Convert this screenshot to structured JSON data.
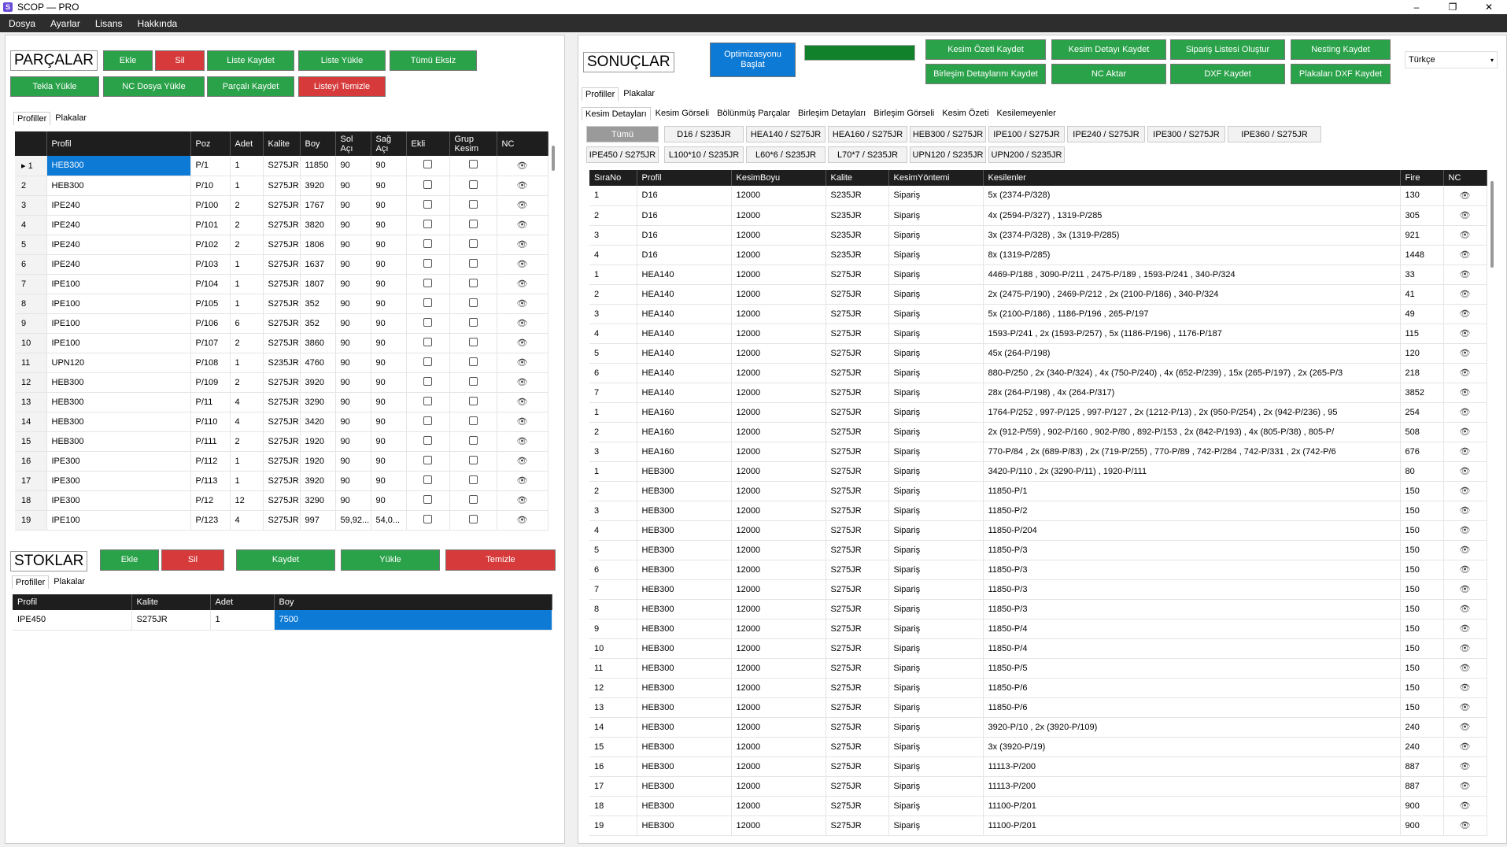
{
  "window": {
    "title": "SCOP — PRO",
    "icon_letter": "S",
    "controls": [
      "–",
      "❐",
      "✕"
    ]
  },
  "menu": [
    "Dosya",
    "Ayarlar",
    "Lisans",
    "Hakkında"
  ],
  "parts": {
    "title": "PARÇALAR",
    "buttons": {
      "add": "Ekle",
      "delete": "Sil",
      "save_list": "Liste Kaydet",
      "load_list": "Liste Yükle",
      "all_missing": "Tümü Eksiz",
      "tekla_load": "Tekla Yükle",
      "nc_load": "NC Dosya Yükle",
      "save_parts": "Parçalı Kaydet",
      "clear_list": "Listeyi Temizle"
    },
    "tabs": [
      "Profiller",
      "Plakalar"
    ],
    "columns": [
      "Profil",
      "Poz",
      "Adet",
      "Kalite",
      "Boy",
      "Sol Açı",
      "Sağ Açı",
      "Ekli",
      "Grup Kesim",
      "NC"
    ],
    "rows": [
      [
        "1",
        "HEB300",
        "P/1",
        "1",
        "S275JR",
        "11850",
        "90",
        "90"
      ],
      [
        "2",
        "HEB300",
        "P/10",
        "1",
        "S275JR",
        "3920",
        "90",
        "90"
      ],
      [
        "3",
        "IPE240",
        "P/100",
        "2",
        "S275JR",
        "1767",
        "90",
        "90"
      ],
      [
        "4",
        "IPE240",
        "P/101",
        "2",
        "S275JR",
        "3820",
        "90",
        "90"
      ],
      [
        "5",
        "IPE240",
        "P/102",
        "2",
        "S275JR",
        "1806",
        "90",
        "90"
      ],
      [
        "6",
        "IPE240",
        "P/103",
        "1",
        "S275JR",
        "1637",
        "90",
        "90"
      ],
      [
        "7",
        "IPE100",
        "P/104",
        "1",
        "S275JR",
        "1807",
        "90",
        "90"
      ],
      [
        "8",
        "IPE100",
        "P/105",
        "1",
        "S275JR",
        "352",
        "90",
        "90"
      ],
      [
        "9",
        "IPE100",
        "P/106",
        "6",
        "S275JR",
        "352",
        "90",
        "90"
      ],
      [
        "10",
        "IPE100",
        "P/107",
        "2",
        "S275JR",
        "3860",
        "90",
        "90"
      ],
      [
        "11",
        "UPN120",
        "P/108",
        "1",
        "S235JR",
        "4760",
        "90",
        "90"
      ],
      [
        "12",
        "HEB300",
        "P/109",
        "2",
        "S275JR",
        "3920",
        "90",
        "90"
      ],
      [
        "13",
        "HEB300",
        "P/11",
        "4",
        "S275JR",
        "3290",
        "90",
        "90"
      ],
      [
        "14",
        "HEB300",
        "P/110",
        "4",
        "S275JR",
        "3420",
        "90",
        "90"
      ],
      [
        "15",
        "HEB300",
        "P/111",
        "2",
        "S275JR",
        "1920",
        "90",
        "90"
      ],
      [
        "16",
        "IPE300",
        "P/112",
        "1",
        "S275JR",
        "1920",
        "90",
        "90"
      ],
      [
        "17",
        "IPE300",
        "P/113",
        "1",
        "S275JR",
        "3920",
        "90",
        "90"
      ],
      [
        "18",
        "IPE300",
        "P/12",
        "12",
        "S275JR",
        "3290",
        "90",
        "90"
      ],
      [
        "19",
        "IPE100",
        "P/123",
        "4",
        "S275JR",
        "997",
        "59,92...",
        "54,0..."
      ]
    ]
  },
  "stocks": {
    "title": "STOKLAR",
    "buttons": {
      "add": "Ekle",
      "delete": "Sil",
      "save": "Kaydet",
      "load": "Yükle",
      "clear": "Temizle"
    },
    "tabs": [
      "Profiller",
      "Plakalar"
    ],
    "columns": [
      "Profil",
      "Kalite",
      "Adet",
      "Boy"
    ],
    "rows": [
      [
        "IPE450",
        "S275JR",
        "1",
        "7500"
      ]
    ]
  },
  "results": {
    "title": "SONUÇLAR",
    "start_button": "Optimizasyonu Başlat",
    "progress": 1.0,
    "buttons": {
      "cut_summary": "Kesim Özeti Kaydet",
      "cut_detail": "Kesim Detayı Kaydet",
      "order_list": "Sipariş Listesi Oluştur",
      "nesting": "Nesting Kaydet",
      "merge_details": "Birleşim Detaylarını Kaydet",
      "nc_export": "NC Aktar",
      "dxf": "DXF Kaydet",
      "plate_dxf": "Plakaları DXF Kaydet"
    },
    "language": "Türkçe",
    "tabs1": [
      "Profiller",
      "Plakalar"
    ],
    "tabs2": [
      "Kesim Detayları",
      "Kesim Görseli",
      "Bölünmüş Parçalar",
      "Birleşim Detayları",
      "Birleşim Görseli",
      "Kesim Özeti",
      "Kesilemeyenler"
    ],
    "filters": [
      "Tümü",
      "D16 / S235JR",
      "HEA140 / S275JR",
      "HEA160 / S275JR",
      "HEB300 / S275JR",
      "IPE100 / S275JR",
      "IPE240 / S275JR",
      "IPE300 / S275JR",
      "IPE360 / S275JR",
      "IPE450 / S275JR",
      "L100*10 / S235JR",
      "L60*6 / S235JR",
      "L70*7 / S235JR",
      "UPN120 / S235JR",
      "UPN200 / S235JR"
    ],
    "columns": [
      "SıraNo",
      "Profil",
      "KesimBoyu",
      "Kalite",
      "KesimYöntemi",
      "Kesilenler",
      "Fire",
      "NC"
    ],
    "rows": [
      [
        "1",
        "D16",
        "12000",
        "S235JR",
        "Sipariş",
        "5x (2374-P/328)",
        "130"
      ],
      [
        "2",
        "D16",
        "12000",
        "S235JR",
        "Sipariş",
        "4x (2594-P/327) ,   1319-P/285",
        "305"
      ],
      [
        "3",
        "D16",
        "12000",
        "S235JR",
        "Sipariş",
        "3x (2374-P/328) ,   3x (1319-P/285)",
        "921"
      ],
      [
        "4",
        "D16",
        "12000",
        "S235JR",
        "Sipariş",
        "8x (1319-P/285)",
        "1448"
      ],
      [
        "1",
        "HEA140",
        "12000",
        "S275JR",
        "Sipariş",
        "4469-P/188 ,   3090-P/211 ,   2475-P/189 ,   1593-P/241 ,   340-P/324",
        "33"
      ],
      [
        "2",
        "HEA140",
        "12000",
        "S275JR",
        "Sipariş",
        "2x (2475-P/190) ,   2469-P/212 ,   2x (2100-P/186) ,   340-P/324",
        "41"
      ],
      [
        "3",
        "HEA140",
        "12000",
        "S275JR",
        "Sipariş",
        "5x (2100-P/186) ,   1186-P/196 ,   265-P/197",
        "49"
      ],
      [
        "4",
        "HEA140",
        "12000",
        "S275JR",
        "Sipariş",
        "1593-P/241 ,   2x (1593-P/257) ,   5x (1186-P/196) ,   1176-P/187",
        "115"
      ],
      [
        "5",
        "HEA140",
        "12000",
        "S275JR",
        "Sipariş",
        "45x (264-P/198)",
        "120"
      ],
      [
        "6",
        "HEA140",
        "12000",
        "S275JR",
        "Sipariş",
        "880-P/250 ,   2x (340-P/324) ,   4x (750-P/240) ,   4x (652-P/239) ,   15x (265-P/197) ,   2x (265-P/3",
        "218"
      ],
      [
        "7",
        "HEA140",
        "12000",
        "S275JR",
        "Sipariş",
        "28x (264-P/198) ,   4x (264-P/317)",
        "3852"
      ],
      [
        "1",
        "HEA160",
        "12000",
        "S275JR",
        "Sipariş",
        "1764-P/252 ,   997-P/125 ,   997-P/127 ,   2x (1212-P/13) ,   2x (950-P/254) ,   2x (942-P/236) ,   95",
        "254"
      ],
      [
        "2",
        "HEA160",
        "12000",
        "S275JR",
        "Sipariş",
        "2x (912-P/59) ,   902-P/160 ,   902-P/80 ,   892-P/153 ,   2x (842-P/193) ,   4x (805-P/38) ,   805-P/",
        "508"
      ],
      [
        "3",
        "HEA160",
        "12000",
        "S275JR",
        "Sipariş",
        "770-P/84 ,   2x (689-P/83) ,   2x (719-P/255) ,   770-P/89 ,   742-P/284 ,   742-P/331 ,   2x (742-P/6",
        "676"
      ],
      [
        "1",
        "HEB300",
        "12000",
        "S275JR",
        "Sipariş",
        "3420-P/110 ,   2x (3290-P/11) ,   1920-P/111",
        "80"
      ],
      [
        "2",
        "HEB300",
        "12000",
        "S275JR",
        "Sipariş",
        "11850-P/1",
        "150"
      ],
      [
        "3",
        "HEB300",
        "12000",
        "S275JR",
        "Sipariş",
        "11850-P/2",
        "150"
      ],
      [
        "4",
        "HEB300",
        "12000",
        "S275JR",
        "Sipariş",
        "11850-P/204",
        "150"
      ],
      [
        "5",
        "HEB300",
        "12000",
        "S275JR",
        "Sipariş",
        "11850-P/3",
        "150"
      ],
      [
        "6",
        "HEB300",
        "12000",
        "S275JR",
        "Sipariş",
        "11850-P/3",
        "150"
      ],
      [
        "7",
        "HEB300",
        "12000",
        "S275JR",
        "Sipariş",
        "11850-P/3",
        "150"
      ],
      [
        "8",
        "HEB300",
        "12000",
        "S275JR",
        "Sipariş",
        "11850-P/3",
        "150"
      ],
      [
        "9",
        "HEB300",
        "12000",
        "S275JR",
        "Sipariş",
        "11850-P/4",
        "150"
      ],
      [
        "10",
        "HEB300",
        "12000",
        "S275JR",
        "Sipariş",
        "11850-P/4",
        "150"
      ],
      [
        "11",
        "HEB300",
        "12000",
        "S275JR",
        "Sipariş",
        "11850-P/5",
        "150"
      ],
      [
        "12",
        "HEB300",
        "12000",
        "S275JR",
        "Sipariş",
        "11850-P/6",
        "150"
      ],
      [
        "13",
        "HEB300",
        "12000",
        "S275JR",
        "Sipariş",
        "11850-P/6",
        "150"
      ],
      [
        "14",
        "HEB300",
        "12000",
        "S275JR",
        "Sipariş",
        "3920-P/10 ,   2x (3920-P/109)",
        "240"
      ],
      [
        "15",
        "HEB300",
        "12000",
        "S275JR",
        "Sipariş",
        "3x (3920-P/19)",
        "240"
      ],
      [
        "16",
        "HEB300",
        "12000",
        "S275JR",
        "Sipariş",
        "11113-P/200",
        "887"
      ],
      [
        "17",
        "HEB300",
        "12000",
        "S275JR",
        "Sipariş",
        "11113-P/200",
        "887"
      ],
      [
        "18",
        "HEB300",
        "12000",
        "S275JR",
        "Sipariş",
        "11100-P/201",
        "900"
      ],
      [
        "19",
        "HEB300",
        "12000",
        "S275JR",
        "Sipariş",
        "11100-P/201",
        "900"
      ]
    ]
  },
  "colors": {
    "green": "#2aa24a",
    "red": "#d63a3a",
    "blue": "#0d7ad6",
    "progress": "#11812c",
    "header": "#1e1e1e"
  }
}
